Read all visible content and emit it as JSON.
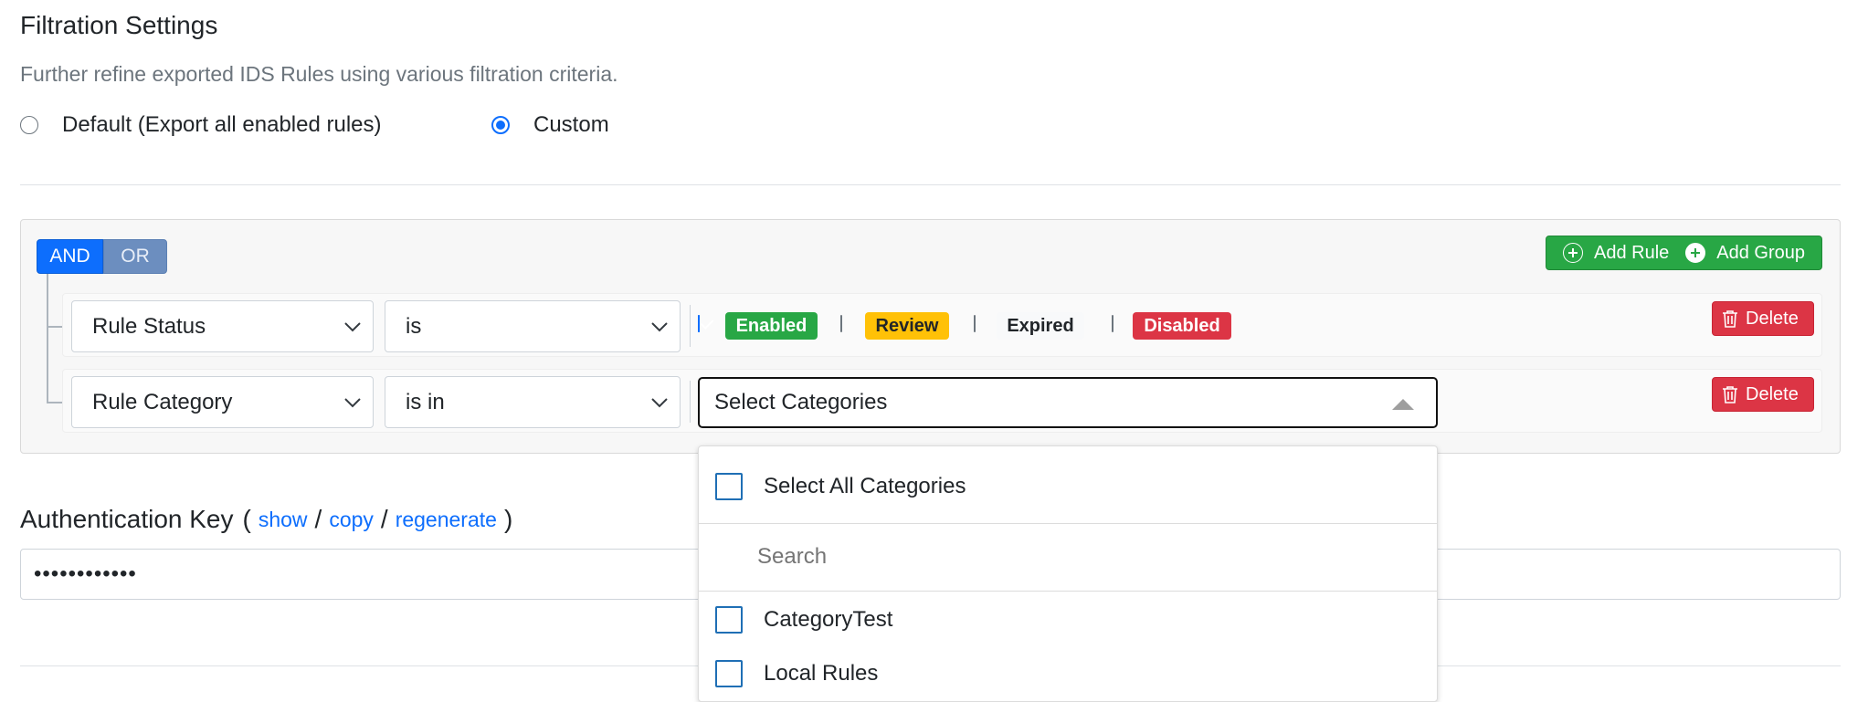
{
  "header": {
    "title": "Filtration Settings",
    "subtitle": "Further refine exported IDS Rules using various filtration criteria."
  },
  "export_mode": {
    "options": [
      {
        "label": "Default (Export all enabled rules)",
        "selected": false
      },
      {
        "label": "Custom",
        "selected": true
      }
    ]
  },
  "builder": {
    "conjunctions": [
      "AND",
      "OR"
    ],
    "active_conjunction": "AND",
    "add_rule_label": "Add Rule",
    "add_group_label": "Add Group",
    "delete_label": "Delete",
    "rules": [
      {
        "field": "Rule Status",
        "operator": "is",
        "statuses": [
          {
            "label": "Enabled",
            "checked": true,
            "color": "#28a745",
            "text_color": "#ffffff"
          },
          {
            "label": "Review",
            "checked": false,
            "color": "#ffc107",
            "text_color": "#212529"
          },
          {
            "label": "Expired",
            "checked": false,
            "color": "#f8f9fa",
            "text_color": "#212529"
          },
          {
            "label": "Disabled",
            "checked": false,
            "color": "#dc3545",
            "text_color": "#ffffff"
          }
        ]
      },
      {
        "field": "Rule Category",
        "operator": "is in",
        "value_placeholder": "Select Categories"
      }
    ]
  },
  "category_dropdown": {
    "select_all_label": "Select All Categories",
    "search_placeholder": "Search",
    "options": [
      "CategoryTest",
      "Local Rules"
    ]
  },
  "auth": {
    "label": "Authentication Key",
    "open_paren": "(",
    "close_paren": ")",
    "slash": "/",
    "links": [
      "show",
      "copy",
      "regenerate"
    ],
    "masked_value": "••••••••••••"
  },
  "colors": {
    "primary": "#0d6efd",
    "success": "#28a745",
    "danger": "#dc3545",
    "warning": "#ffc107"
  }
}
